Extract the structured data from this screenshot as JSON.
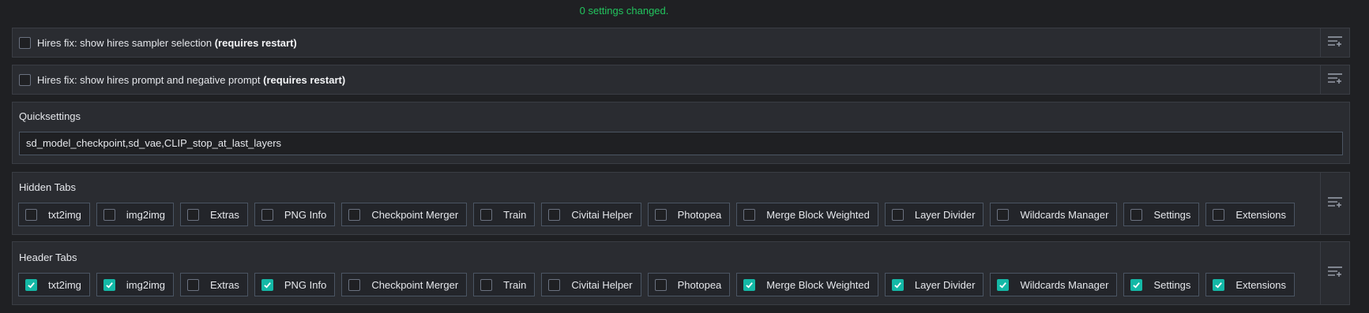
{
  "status_text": "0 settings changed.",
  "colors": {
    "status": "#22c55e",
    "checkbox_checked": "#14b8a6",
    "panel_bg": "#2a2c31",
    "page_bg": "#1f2023"
  },
  "settings": [
    {
      "label": "Hires fix: show hires sampler selection",
      "suffix": "(requires restart)",
      "checked": false
    },
    {
      "label": "Hires fix: show hires prompt and negative prompt",
      "suffix": "(requires restart)",
      "checked": false
    }
  ],
  "quicksettings": {
    "title": "Quicksettings",
    "value": "sd_model_checkpoint,sd_vae,CLIP_stop_at_last_layers"
  },
  "hidden_tabs": {
    "title": "Hidden Tabs",
    "items": [
      {
        "label": "txt2img",
        "checked": false
      },
      {
        "label": "img2img",
        "checked": false
      },
      {
        "label": "Extras",
        "checked": false
      },
      {
        "label": "PNG Info",
        "checked": false
      },
      {
        "label": "Checkpoint Merger",
        "checked": false
      },
      {
        "label": "Train",
        "checked": false
      },
      {
        "label": "Civitai Helper",
        "checked": false
      },
      {
        "label": "Photopea",
        "checked": false
      },
      {
        "label": "Merge Block Weighted",
        "checked": false
      },
      {
        "label": "Layer Divider",
        "checked": false
      },
      {
        "label": "Wildcards Manager",
        "checked": false
      },
      {
        "label": "Settings",
        "checked": false
      },
      {
        "label": "Extensions",
        "checked": false
      }
    ]
  },
  "header_tabs": {
    "title": "Header Tabs",
    "items": [
      {
        "label": "txt2img",
        "checked": true
      },
      {
        "label": "img2img",
        "checked": true
      },
      {
        "label": "Extras",
        "checked": false
      },
      {
        "label": "PNG Info",
        "checked": true
      },
      {
        "label": "Checkpoint Merger",
        "checked": false
      },
      {
        "label": "Train",
        "checked": false
      },
      {
        "label": "Civitai Helper",
        "checked": false
      },
      {
        "label": "Photopea",
        "checked": false
      },
      {
        "label": "Merge Block Weighted",
        "checked": true
      },
      {
        "label": "Layer Divider",
        "checked": true
      },
      {
        "label": "Wildcards Manager",
        "checked": true
      },
      {
        "label": "Settings",
        "checked": true
      },
      {
        "label": "Extensions",
        "checked": true
      }
    ]
  },
  "icons": {
    "reload": "list-plus-icon",
    "check": "check-icon"
  }
}
